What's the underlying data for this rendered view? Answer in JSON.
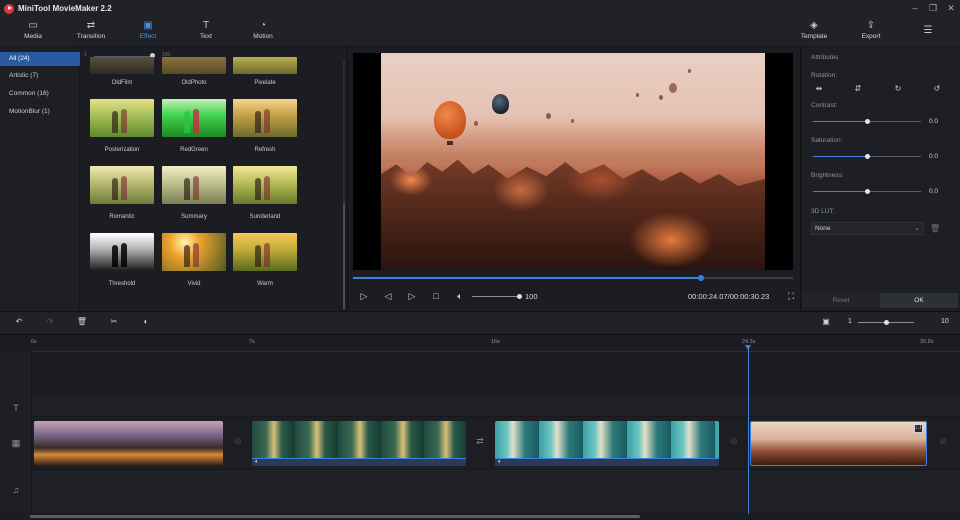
{
  "window": {
    "title": "MiniTool MovieMaker 2.2"
  },
  "toolbar": {
    "items": [
      {
        "label": "Media",
        "icon": "folder-icon"
      },
      {
        "label": "Transition",
        "icon": "transition-icon"
      },
      {
        "label": "Effect",
        "icon": "effect-icon"
      },
      {
        "label": "Text",
        "icon": "text-icon"
      },
      {
        "label": "Motion",
        "icon": "motion-icon"
      }
    ],
    "active": "Effect",
    "template_label": "Template",
    "export_label": "Export"
  },
  "categories": [
    {
      "label": "All (24)",
      "selected": true
    },
    {
      "label": "Artistic (7)",
      "selected": false
    },
    {
      "label": "Common (16)",
      "selected": false
    },
    {
      "label": "MotionBlur (1)",
      "selected": false
    }
  ],
  "effect_slider": {
    "min": "1",
    "max": "100"
  },
  "effects": [
    "OldFilm",
    "OldPhoto",
    "Pixelate",
    "Posterization",
    "RedGreen",
    "Refresh",
    "Romantic",
    "Summary",
    "Sunderland",
    "Threshold",
    "Vivid",
    "Warm"
  ],
  "player": {
    "progress_fraction": 0.79,
    "volume": "100",
    "timecode": "00:00:24.07/00:00:30.23"
  },
  "attributes": {
    "header": "Attributes",
    "rotation_label": "Rotation:",
    "contrast_label": "Contrast:",
    "contrast_value": "0.0",
    "saturation_label": "Saturation:",
    "saturation_value": "0.0",
    "brightness_label": "Brightness:",
    "brightness_value": "0.0",
    "lut_label": "3D LUT:",
    "lut_value": "None",
    "reset_label": "Reset",
    "ok_label": "OK"
  },
  "timeline": {
    "ruler": [
      "0s",
      "7s",
      "16s",
      "24.3s",
      "30.8s"
    ],
    "zoom_min": "1",
    "zoom_max": "10",
    "zoom_fraction": 0.5
  },
  "colors": {
    "accent": "#3b82e0",
    "selected_category": "#2a5aa0",
    "logo": "#e5343a"
  }
}
